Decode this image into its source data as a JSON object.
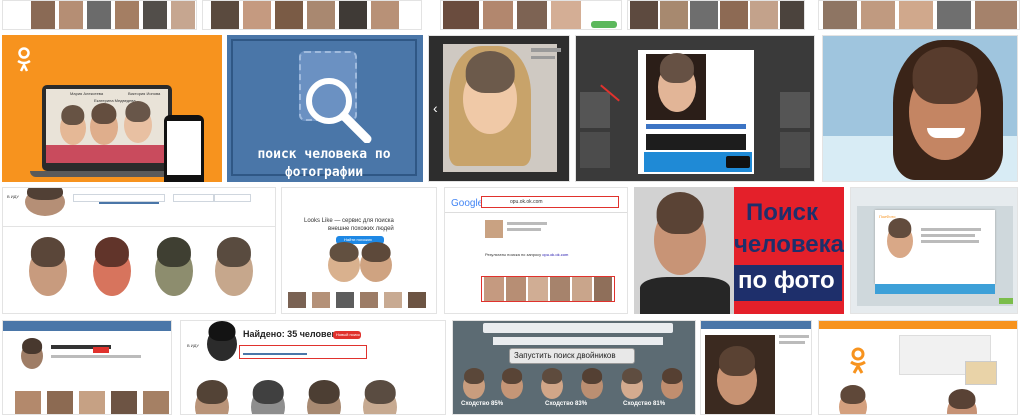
{
  "tiles": {
    "ok_promo": {
      "photo_names": [
        "Мария Алексеева",
        "Екатерина Медведева",
        "Виктория Ионова"
      ]
    },
    "vk_search": {
      "caption_line1": "поиск человека по",
      "caption_line2": "фотографии"
    },
    "looks_like": {
      "headline": "Looks Like — сервис для поиска",
      "subline": "внешне похожих людей",
      "button": "Найти похожих"
    },
    "google": {
      "logo": "Google",
      "query": "opu.ok.ok.com",
      "results_label": "Результаты поиска по запросу",
      "results_query": "opu.ok.ok.com"
    },
    "banner": {
      "line1": "Поиск",
      "line2": "человека",
      "line3": "по фото"
    },
    "found35": {
      "title": "Найдено: 35 человек",
      "badge": "Новый поиск"
    },
    "twins": {
      "button": "Запустить поиск двойников",
      "similarity": [
        "Сходство 85%",
        "Сходство 83%",
        "Сходство 81%"
      ]
    }
  },
  "colors": {
    "ok_orange": "#f7931e",
    "vk_blue": "#4a76a8",
    "banner_red": "#e4202a",
    "banner_navy": "#1e2f6b",
    "highlight_red": "#e0322d"
  }
}
